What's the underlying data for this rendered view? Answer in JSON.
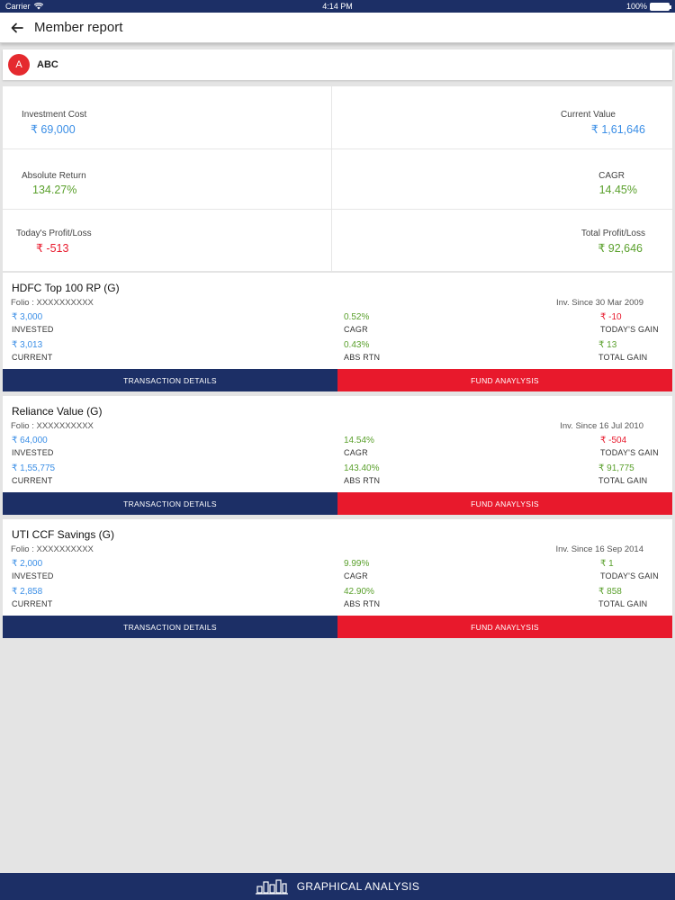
{
  "status_bar": {
    "carrier": "Carrier",
    "time": "4:14 PM",
    "battery": "100%"
  },
  "header": {
    "title": "Member report",
    "back_icon": "arrow-left-icon"
  },
  "member": {
    "initial": "A",
    "name": "ABC",
    "avatar_color": "#e52a2f"
  },
  "summary": {
    "investment_cost": {
      "label": "Investment Cost",
      "value": "₹ 69,000"
    },
    "current_value": {
      "label": "Current Value",
      "value": "₹ 1,61,646"
    },
    "absolute_return": {
      "label": "Absolute Return",
      "value": "134.27%"
    },
    "cagr": {
      "label": "CAGR",
      "value": "14.45%"
    },
    "todays_pl": {
      "label": "Today's Profit/Loss",
      "value": "₹ -513"
    },
    "total_pl": {
      "label": "Total Profit/Loss",
      "value": "₹ 92,646"
    }
  },
  "funds": [
    {
      "name": "HDFC Top 100 RP (G)",
      "folio": "Folio : XXXXXXXXXX",
      "inv_since": "Inv. Since 30 Mar 2009",
      "invested": "₹ 3,000",
      "current": "₹ 3,013",
      "cagr": "0.52%",
      "abs_rtn": "0.43%",
      "todays_gain": "₹ -10",
      "total_gain": "₹ 13"
    },
    {
      "name": "Reliance Value (G)",
      "folio": "Folio : XXXXXXXXXX",
      "inv_since": "Inv. Since 16 Jul 2010",
      "invested": "₹ 64,000",
      "current": "₹ 1,55,775",
      "cagr": "14.54%",
      "abs_rtn": "143.40%",
      "todays_gain": "₹ -504",
      "total_gain": "₹ 91,775"
    },
    {
      "name": "UTI CCF Savings (G)",
      "folio": "Folio : XXXXXXXXXX",
      "inv_since": "Inv. Since 16 Sep 2014",
      "invested": "₹ 2,000",
      "current": "₹ 2,858",
      "cagr": "9.99%",
      "abs_rtn": "42.90%",
      "todays_gain": "₹ 1",
      "total_gain": "₹ 858"
    }
  ],
  "labels": {
    "invested": "INVESTED",
    "current": "CURRENT",
    "cagr": "CAGR",
    "abs_rtn": "ABS RTN",
    "todays_gain": "TODAY'S GAIN",
    "total_gain": "TOTAL GAIN",
    "transaction_details": "TRANSACTION DETAILS",
    "fund_analysis": "FUND ANAYLYSIS"
  },
  "bottom": {
    "label": "GRAPHICAL ANALYSIS",
    "icon": "bar-chart-icon"
  },
  "colors": {
    "navy": "#1c2f66",
    "red": "#e8192c",
    "blue": "#3a8ee6",
    "green": "#5aa02c",
    "background": "#e4e4e4"
  }
}
